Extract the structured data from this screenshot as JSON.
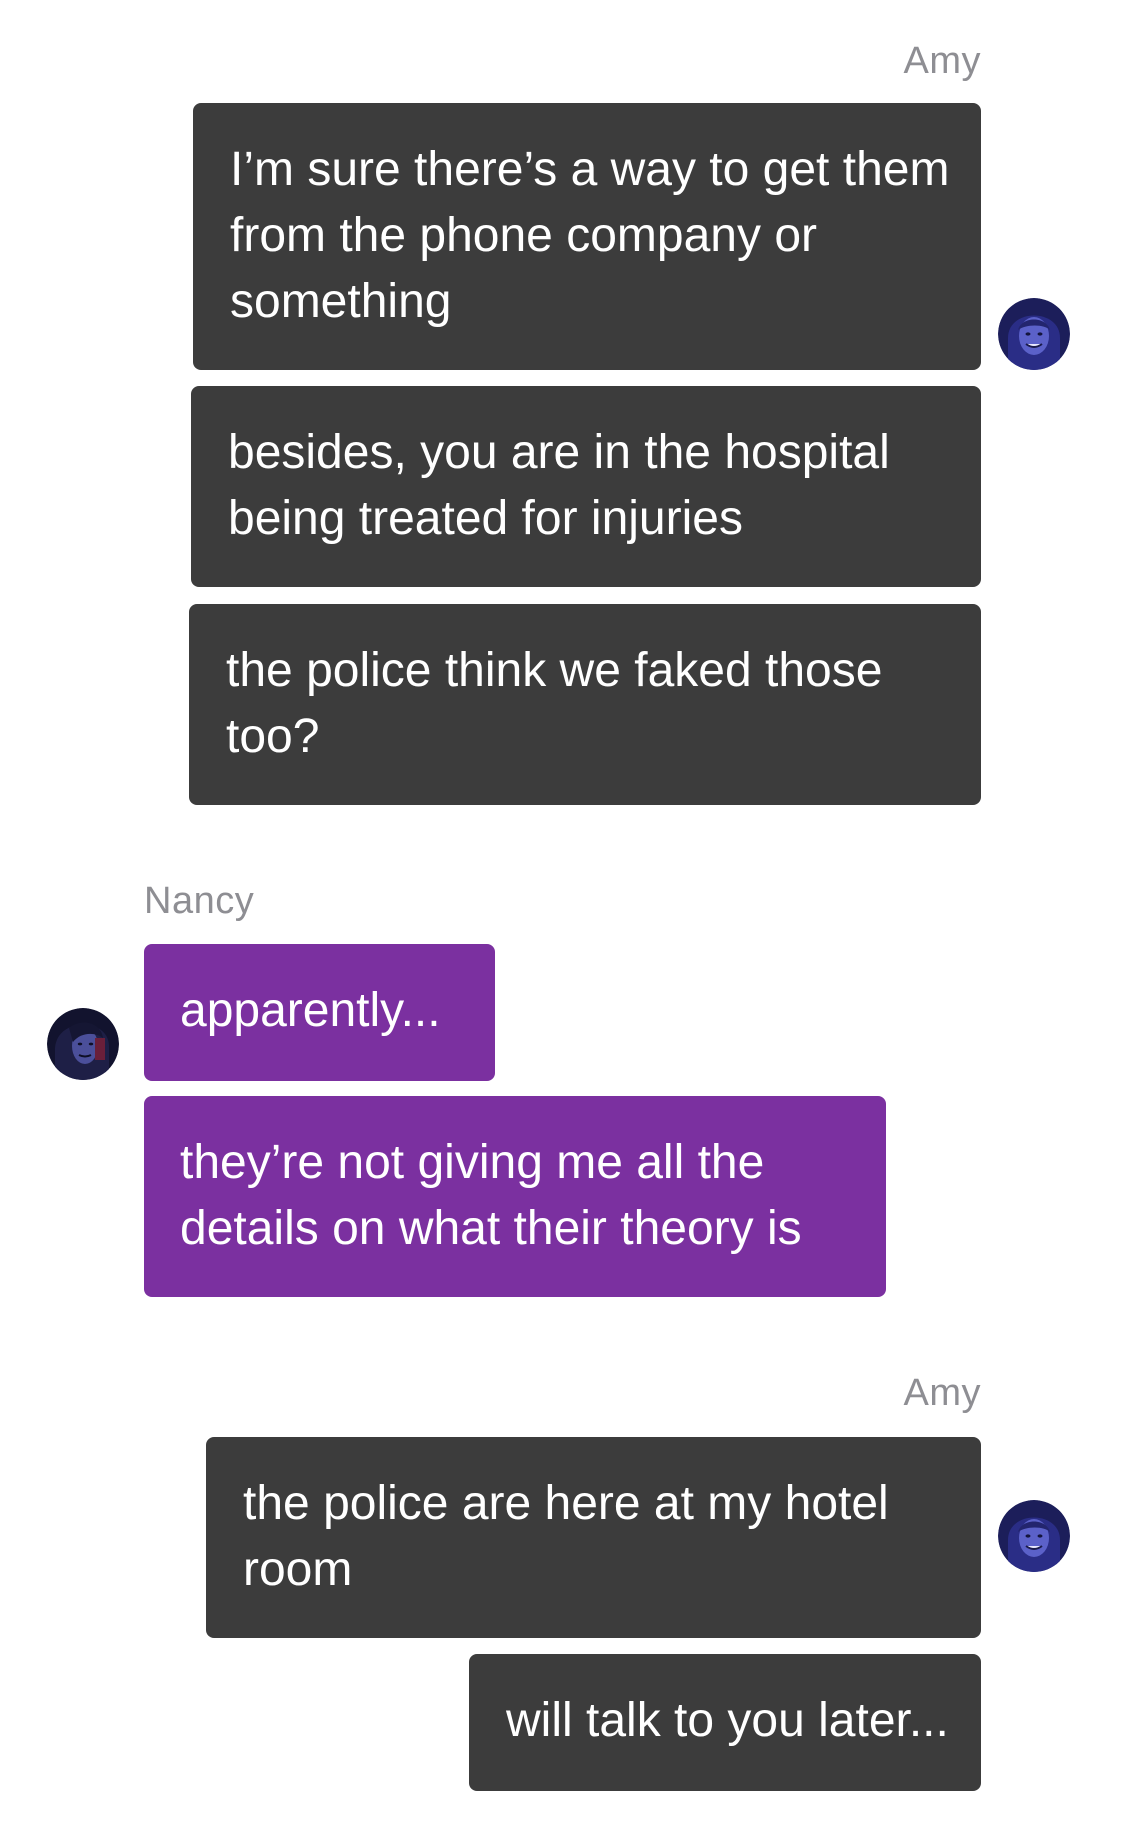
{
  "messages": [
    {
      "sender": "Amy",
      "texts": [
        "I’m sure there’s a way to get them from the phone company or something",
        "besides, you are in the hospital being treated for injuries",
        "the police think we faked those too?"
      ],
      "avatar_icon": "amy-avatar-icon"
    },
    {
      "sender": "Nancy",
      "texts": [
        "apparently...",
        "they’re not giving me all the details on what their theory is"
      ],
      "avatar_icon": "nancy-avatar-icon"
    },
    {
      "sender": "Amy",
      "texts": [
        "the police are here at my hotel room",
        "will talk to you later..."
      ],
      "avatar_icon": "amy-avatar-icon"
    }
  ],
  "colors": {
    "amy_bubble": "#3c3c3c",
    "nancy_bubble": "#7b30a0",
    "sender_label": "#8e8e93",
    "background": "#ffffff"
  }
}
